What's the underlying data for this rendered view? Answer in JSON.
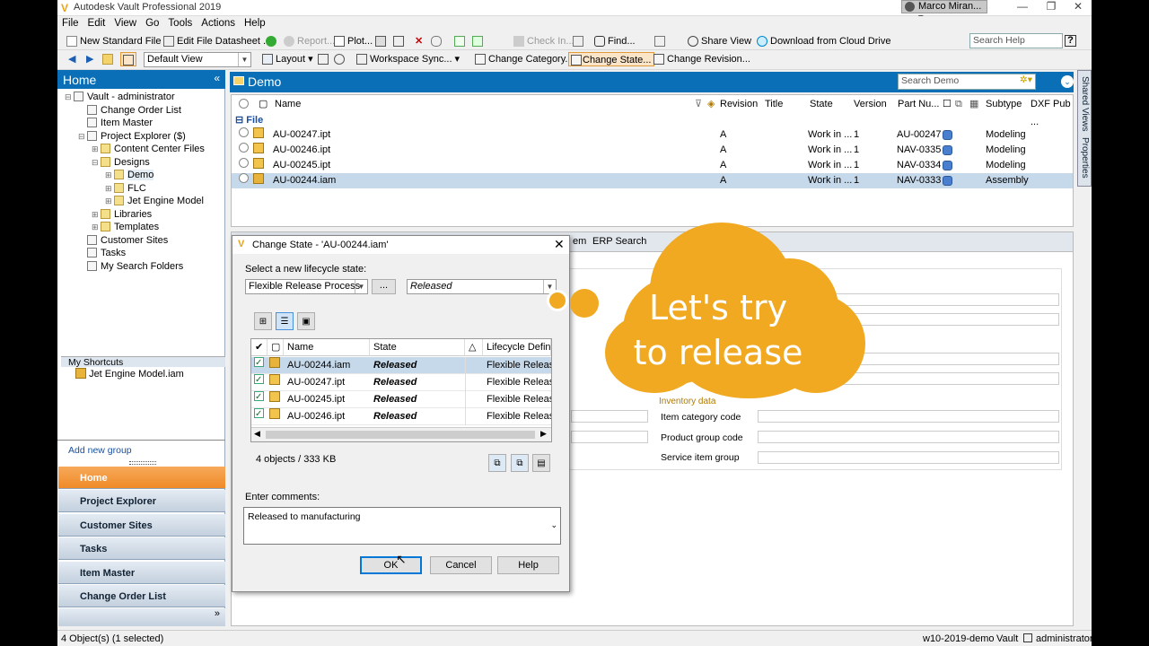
{
  "window": {
    "title": "Autodesk Vault Professional 2019",
    "user": "Marco Miran...",
    "controls": [
      "—",
      "❐",
      "✕"
    ]
  },
  "menu": [
    "File",
    "Edit",
    "View",
    "Go",
    "Tools",
    "Actions",
    "Help"
  ],
  "toolbar1": {
    "new_file": "New Standard File ...",
    "edit_datasheet": "Edit File Datasheet ...",
    "report": "Report...",
    "plot": "Plot...",
    "check_in": "Check In...",
    "find": "Find...",
    "share_view": "Share View",
    "download": "Download from Cloud Drive",
    "search_help": "Search Help"
  },
  "toolbar2": {
    "view": "Default View",
    "layout": "Layout",
    "workspace_sync": "Workspace Sync...",
    "change_category": "Change Category...",
    "change_state": "Change State...",
    "change_revision": "Change Revision..."
  },
  "nav": {
    "home_title": "Home",
    "tree": [
      {
        "label": "Vault - administrator",
        "indent": 0,
        "exp": "⊟"
      },
      {
        "label": "Change Order List",
        "indent": 1,
        "exp": ""
      },
      {
        "label": "Item Master",
        "indent": 1,
        "exp": ""
      },
      {
        "label": "Project Explorer ($)",
        "indent": 1,
        "exp": "⊟"
      },
      {
        "label": "Content Center Files",
        "indent": 2,
        "exp": "⊞"
      },
      {
        "label": "Designs",
        "indent": 2,
        "exp": "⊟"
      },
      {
        "label": "Demo",
        "indent": 3,
        "exp": "⊞"
      },
      {
        "label": "FLC",
        "indent": 3,
        "exp": "⊞"
      },
      {
        "label": "Jet Engine Model",
        "indent": 3,
        "exp": "⊞"
      },
      {
        "label": "Libraries",
        "indent": 2,
        "exp": "⊞"
      },
      {
        "label": "Templates",
        "indent": 2,
        "exp": "⊞"
      },
      {
        "label": "Customer Sites",
        "indent": 1,
        "exp": ""
      },
      {
        "label": "Tasks",
        "indent": 1,
        "exp": ""
      },
      {
        "label": "My Search Folders",
        "indent": 1,
        "exp": ""
      }
    ],
    "shortcuts_title": "My Shortcuts",
    "shortcut_item": "Jet Engine Model.iam",
    "add_group": "Add new group",
    "buttons": [
      "Home",
      "Project Explorer",
      "Customer Sites",
      "Tasks",
      "Item Master",
      "Change Order List"
    ]
  },
  "main": {
    "title": "Demo",
    "search_placeholder": "Search Demo",
    "columns": [
      "Name",
      "Revision",
      "Title",
      "State",
      "Version",
      "Part Nu...",
      "Subtype",
      "DXF Pub ..."
    ],
    "group": "File",
    "rows": [
      {
        "name": "AU-00247.ipt",
        "rev": "A",
        "state": "Work in ...",
        "ver": "1",
        "part": "AU-00247",
        "subtype": "Modeling",
        "sel": false
      },
      {
        "name": "AU-00246.ipt",
        "rev": "A",
        "state": "Work in ...",
        "ver": "1",
        "part": "NAV-0335",
        "subtype": "Modeling",
        "sel": false
      },
      {
        "name": "AU-00245.ipt",
        "rev": "A",
        "state": "Work in ...",
        "ver": "1",
        "part": "NAV-0334",
        "subtype": "Modeling",
        "sel": false
      },
      {
        "name": "AU-00244.iam",
        "rev": "A",
        "state": "Work in ...",
        "ver": "1",
        "part": "NAV-0333",
        "subtype": "Assembly",
        "sel": true
      }
    ],
    "lower_tabs": [
      "em",
      "ERP Search"
    ],
    "inventory_title": "Inventory data",
    "inventory_fields": [
      "Item category code",
      "Product group code",
      "Service item group"
    ]
  },
  "dialog": {
    "title": "Change State - 'AU-00244.iam'",
    "select_label": "Select a new lifecycle state:",
    "process": "Flexible Release Process",
    "ellipsis": "...",
    "state": "Released",
    "columns": [
      "Name",
      "State",
      "Lifecycle Definiti"
    ],
    "rows": [
      {
        "name": "AU-00244.iam",
        "state": "Released",
        "lc": "Flexible Release F",
        "sel": true
      },
      {
        "name": "AU-00247.ipt",
        "state": "Released",
        "lc": "Flexible Release F",
        "sel": false
      },
      {
        "name": "AU-00245.ipt",
        "state": "Released",
        "lc": "Flexible Release F",
        "sel": false
      },
      {
        "name": "AU-00246.ipt",
        "state": "Released",
        "lc": "Flexible Release F",
        "sel": false
      }
    ],
    "summary": "4 objects / 333 KB",
    "comments_label": "Enter comments:",
    "comments": "Released to manufacturing",
    "ok": "OK",
    "cancel": "Cancel",
    "help": "Help"
  },
  "callout": {
    "line1": "Let's try",
    "line2": "to release",
    "color": "#f0a921"
  },
  "status": {
    "left": "4 Object(s) (1 selected)",
    "server": "w10-2019-demo",
    "vault": "Vault",
    "user": "administrator"
  },
  "side_tabs": [
    "Shared Views",
    "Properties"
  ]
}
